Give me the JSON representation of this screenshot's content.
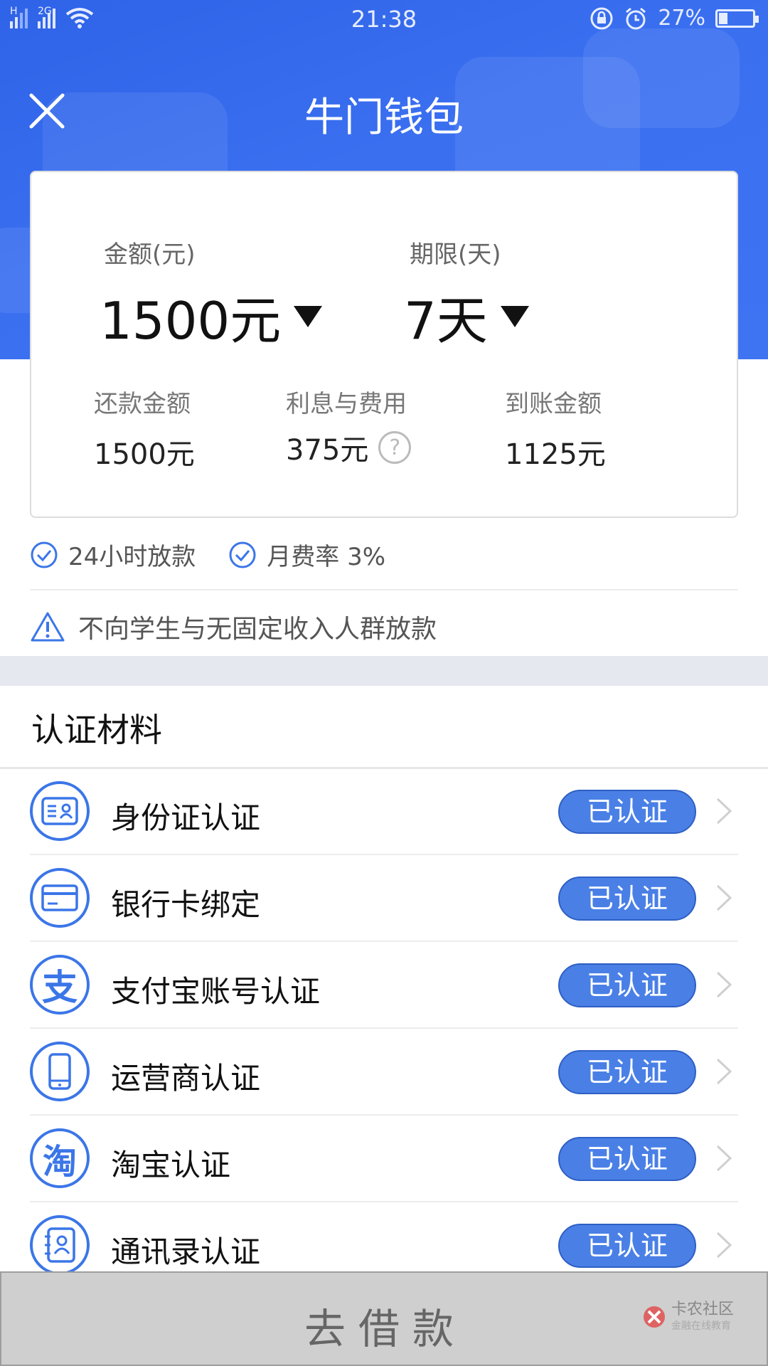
{
  "status_bar": {
    "network_1": "H",
    "network_2": "2G",
    "time": "21:38",
    "battery": "27%"
  },
  "header": {
    "title": "牛门钱包"
  },
  "loan": {
    "amount_label": "金额(元)",
    "amount_value": "1500元",
    "term_label": "期限(天)",
    "term_value": "7天",
    "repay_label": "还款金额",
    "repay_value": "1500元",
    "fee_label": "利息与费用",
    "fee_value": "375元",
    "receive_label": "到账金额",
    "receive_value": "1125元"
  },
  "features": [
    {
      "label": "24小时放款"
    },
    {
      "label": "月费率 3%"
    }
  ],
  "warning": "不向学生与无固定收入人群放款",
  "auth_section": {
    "title": "认证材料",
    "items": [
      {
        "label": "身份证认证",
        "status": "已认证",
        "icon": "id-card-icon"
      },
      {
        "label": "银行卡绑定",
        "status": "已认证",
        "icon": "bank-card-icon"
      },
      {
        "label": "支付宝账号认证",
        "status": "已认证",
        "icon": "alipay-icon"
      },
      {
        "label": "运营商认证",
        "status": "已认证",
        "icon": "phone-icon"
      },
      {
        "label": "淘宝认证",
        "status": "已认证",
        "icon": "taobao-icon"
      },
      {
        "label": "通讯录认证",
        "status": "已认证",
        "icon": "contacts-icon"
      }
    ]
  },
  "footer": {
    "borrow_button": "去借款",
    "watermark_title": "卡农社区",
    "watermark_sub": "金融在线教育"
  },
  "colors": {
    "header_blue": "#3a6ff0",
    "badge_blue": "#4a80e6",
    "icon_blue": "#3b76e8"
  }
}
